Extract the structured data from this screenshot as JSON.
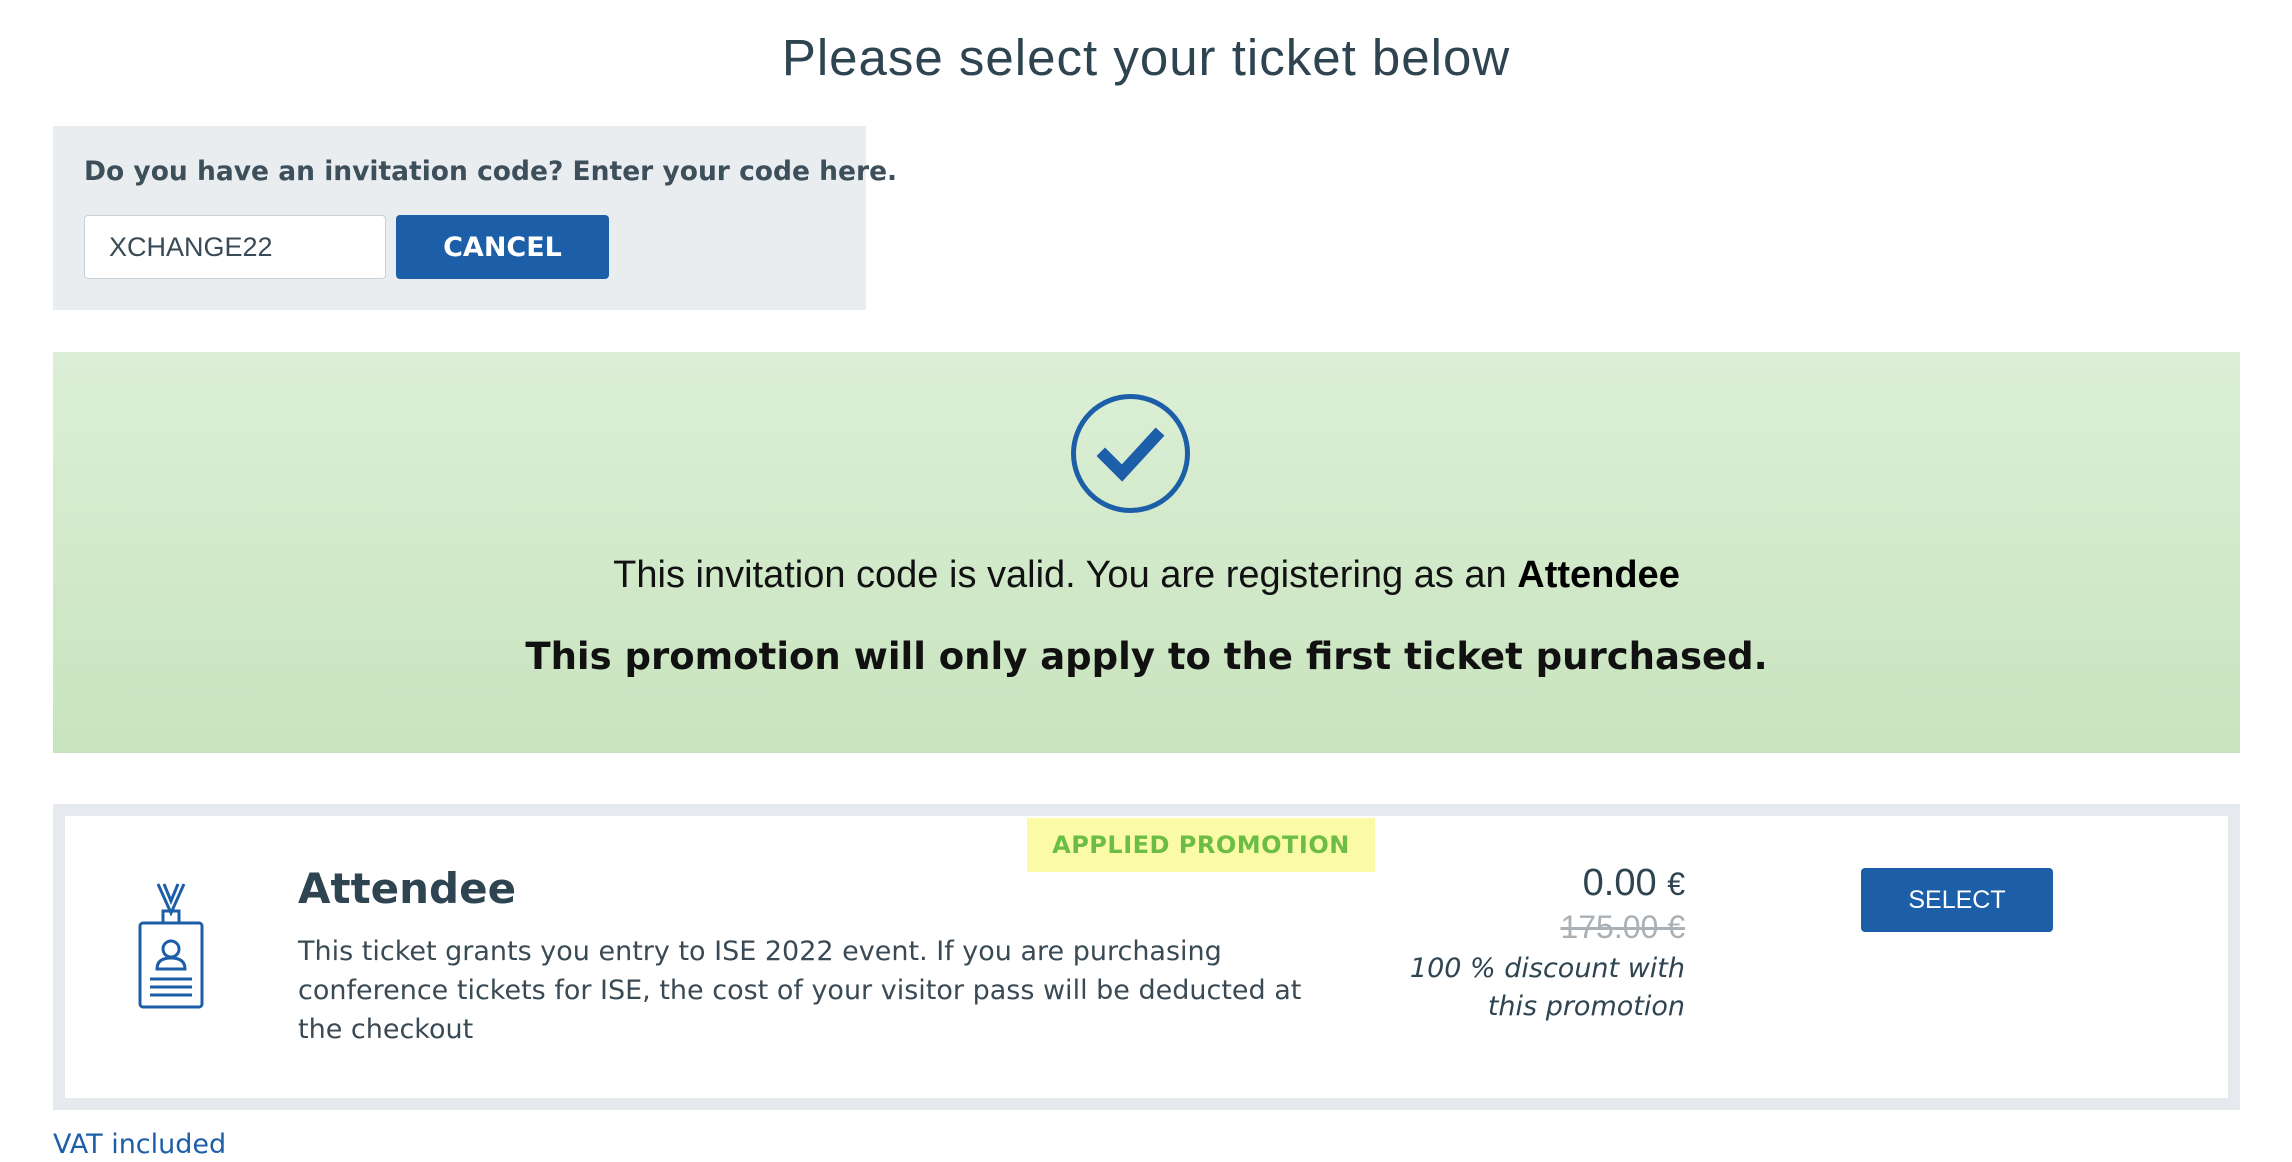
{
  "page": {
    "title": "Please select your ticket below"
  },
  "invitation": {
    "prompt": "Do you have an invitation code? Enter your code here.",
    "code_value": "XCHANGE22",
    "cancel_label": "CANCEL"
  },
  "validation": {
    "message_prefix": "This invitation code is valid. You are registering as an",
    "role": "Attendee",
    "promo_note": "This promotion will only apply to the first ticket purchased.",
    "icon": "check-circle-icon"
  },
  "ticket": {
    "badge": "APPLIED PROMOTION",
    "icon": "id-badge-icon",
    "name": "Attendee",
    "description": "This ticket grants you entry to ISE 2022 event. If you are purchasing conference tickets for ISE, the cost of your visitor pass will be deducted at the checkout",
    "price": "0.00",
    "currency": "€",
    "original_price": "175.00 €",
    "discount_note": "100 % discount with this promotion",
    "select_label": "SELECT"
  },
  "footer": {
    "vat_label": "VAT included"
  },
  "colors": {
    "primary": "#1d5ea8",
    "banner_green": "#d4ebcc",
    "badge_bg": "#fbfaa6",
    "badge_text": "#6cbd45",
    "panel_gray": "#e9edf0"
  }
}
